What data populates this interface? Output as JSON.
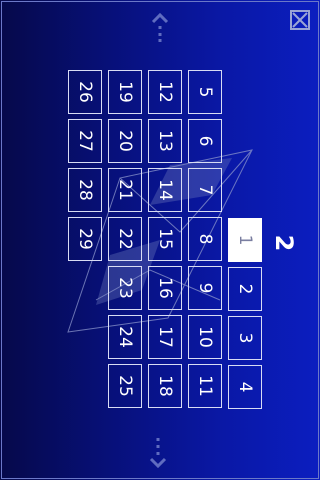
{
  "month_label": "2",
  "selected_day": "1",
  "days": {
    "col1": [
      "1",
      "2",
      "3",
      "4"
    ],
    "col2": [
      "5",
      "6",
      "7",
      "8",
      "9",
      "10",
      "11"
    ],
    "col3": [
      "12",
      "13",
      "14",
      "15",
      "16",
      "17",
      "18"
    ],
    "col4": [
      "19",
      "20",
      "21",
      "22",
      "23",
      "24",
      "25"
    ],
    "col5": [
      "26",
      "27",
      "28",
      "29"
    ]
  },
  "icons": {
    "close": "close-icon",
    "scroll_up": "scroll-up-arrow-icon",
    "scroll_down": "scroll-down-arrow-icon",
    "watermark": "logo-watermark"
  },
  "colors": {
    "background": "#0a18a6",
    "cell_border": "#d8dcf4",
    "selected_fill": "#ffffff"
  }
}
